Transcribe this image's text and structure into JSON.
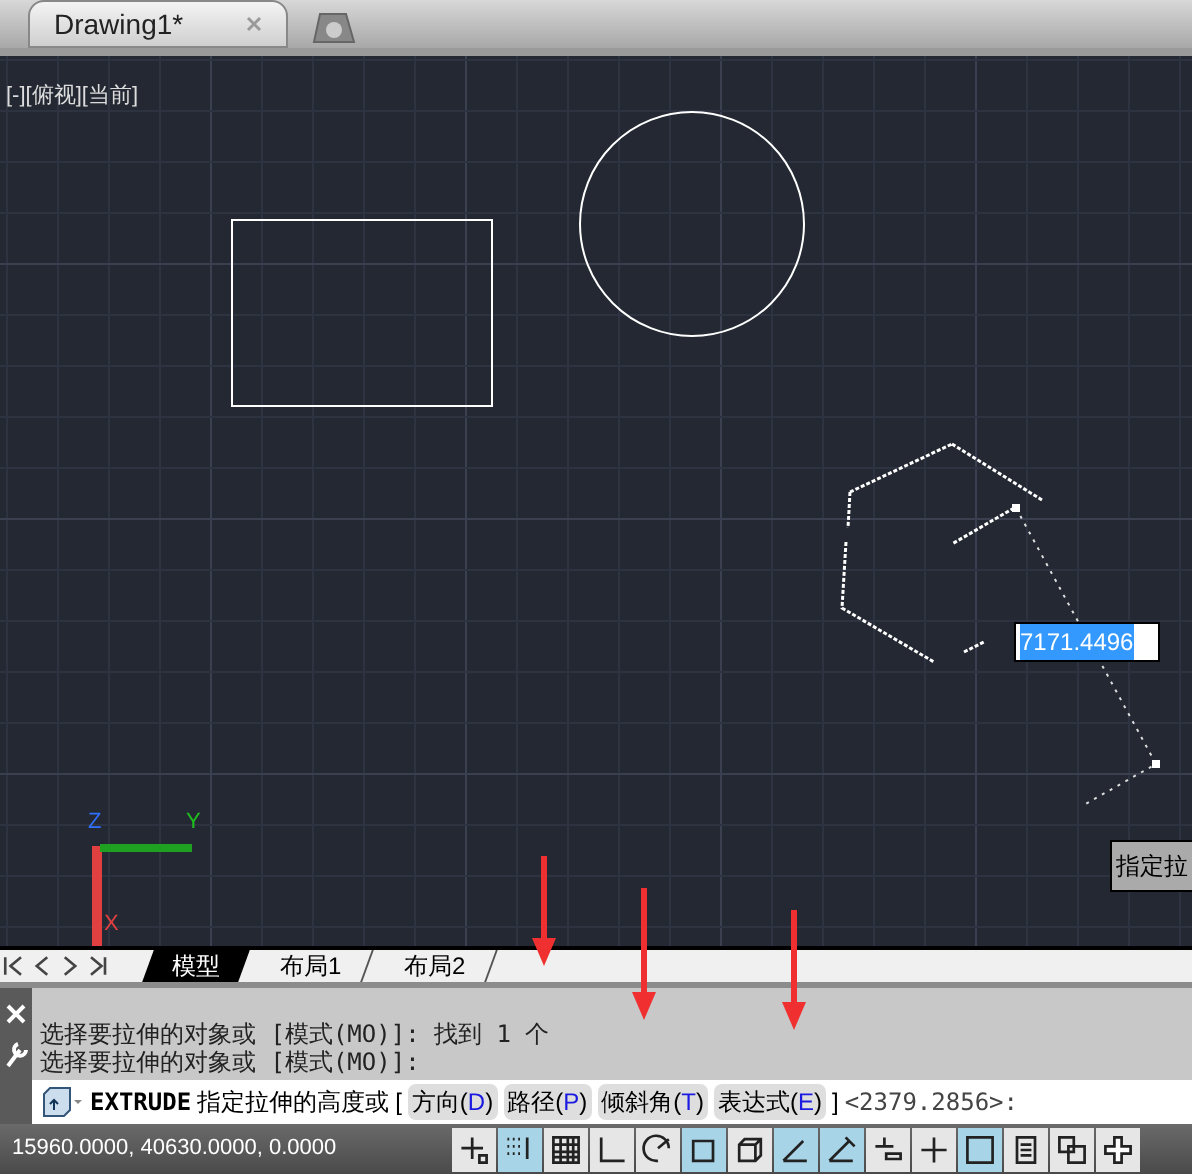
{
  "document_tabs": [
    {
      "label": "Drawing1*",
      "selected": true
    }
  ],
  "viewport": {
    "label": "[-][俯视][当前]",
    "dimension_input": "7171.4496",
    "tooltip": "指定拉"
  },
  "ucs": {
    "x_label": "X",
    "y_label": "Y",
    "z_label": "Z"
  },
  "layout_tabs": [
    {
      "label": "模型",
      "selected": true
    },
    {
      "label": "布局1",
      "selected": false
    },
    {
      "label": "布局2",
      "selected": false
    }
  ],
  "command_history": [
    "选择要拉伸的对象或 [模式(MO)]: 找到 1 个",
    "选择要拉伸的对象或 [模式(MO)]:"
  ],
  "command_line": {
    "command": "EXTRUDE",
    "prompt": "指定拉伸的高度或",
    "open_bracket": "[",
    "options": [
      {
        "label": "方向(",
        "key": "D",
        "end": ")"
      },
      {
        "label": "路径(",
        "key": "P",
        "end": ")"
      },
      {
        "label": "倾斜角(",
        "key": "T",
        "end": ")"
      },
      {
        "label": "表达式(",
        "key": "E",
        "end": ")"
      }
    ],
    "close_bracket": "]",
    "default": "<2379.2856>:"
  },
  "status_bar": {
    "coordinates": "15960.0000, 40630.0000, 0.0000",
    "toggles": [
      {
        "kind": "infer",
        "on": false
      },
      {
        "kind": "snap",
        "on": true
      },
      {
        "kind": "grid",
        "on": false
      },
      {
        "kind": "ortho",
        "on": false
      },
      {
        "kind": "polar",
        "on": false
      },
      {
        "kind": "osnap",
        "on": true
      },
      {
        "kind": "osnap3d",
        "on": false
      },
      {
        "kind": "otrack",
        "on": true
      },
      {
        "kind": "ducs",
        "on": true
      },
      {
        "kind": "dyn",
        "on": false
      },
      {
        "kind": "lwt",
        "on": false
      },
      {
        "kind": "transparency",
        "on": true
      },
      {
        "kind": "qp",
        "on": false
      },
      {
        "kind": "sc",
        "on": false
      },
      {
        "kind": "am",
        "on": false
      }
    ]
  }
}
